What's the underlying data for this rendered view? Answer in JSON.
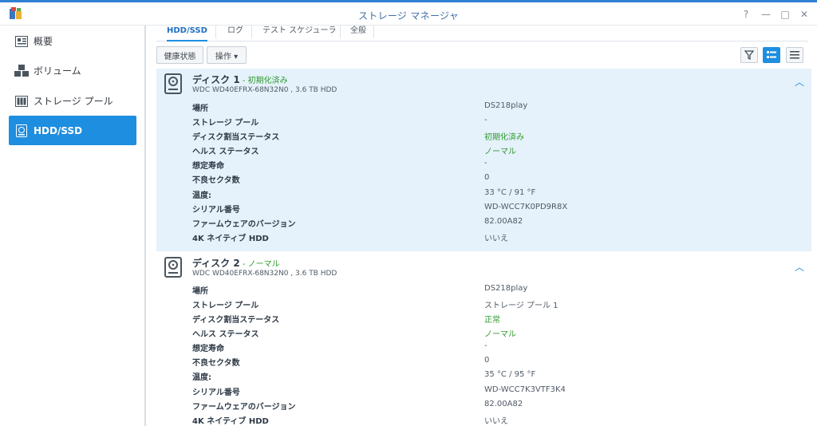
{
  "window": {
    "title": "ストレージ マネージャ",
    "help": "?",
    "minimize": "—",
    "maximize": "□",
    "close": "✕"
  },
  "sidebar": {
    "items": [
      {
        "label": "概要",
        "icon": "overview-icon"
      },
      {
        "label": "ボリューム",
        "icon": "volume-icon"
      },
      {
        "label": "ストレージ プール",
        "icon": "storage-pool-icon"
      },
      {
        "label": "HDD/SSD",
        "icon": "hdd-icon",
        "active": true
      }
    ]
  },
  "tabs": [
    {
      "label": "HDD/SSD",
      "active": true
    },
    {
      "label": "ログ"
    },
    {
      "label": "テスト スケジューラ"
    },
    {
      "label": "全般"
    }
  ],
  "toolbar": {
    "health_label": "健康状態",
    "action_label": "操作 ▾"
  },
  "accent": "#1e8ee0",
  "status_green": "#2e9b2e",
  "disks": [
    {
      "name": "ディスク 1",
      "status": " - 初期化済み",
      "model": "WDC WD40EFRX-68N32N0 , 3.6 TB HDD",
      "rows": [
        {
          "key": "場所",
          "value": "DS218play"
        },
        {
          "key": "ストレージ プール",
          "value": "-"
        },
        {
          "key": "ディスク割当ステータス",
          "value": "初期化済み"
        },
        {
          "key": "ヘルス ステータス",
          "value": "ノーマル"
        },
        {
          "key": "想定寿命",
          "value": "-"
        },
        {
          "key": "不良セクタ数",
          "value": "0"
        },
        {
          "key": "温度:",
          "value": "33 °C / 91 °F"
        },
        {
          "key": "シリアル番号",
          "value": "WD-WCC7K0PD9R8X"
        },
        {
          "key": "ファームウェアのバージョン",
          "value": "82.00A82"
        },
        {
          "key": "4K ネイティブ HDD",
          "value": "いいえ"
        }
      ]
    },
    {
      "name": "ディスク 2",
      "status": " - ノーマル",
      "model": "WDC WD40EFRX-68N32N0 , 3.6 TB HDD",
      "rows": [
        {
          "key": "場所",
          "value": "DS218play"
        },
        {
          "key": "ストレージ プール",
          "value": "ストレージ プール 1"
        },
        {
          "key": "ディスク割当ステータス",
          "value": "正常"
        },
        {
          "key": "ヘルス ステータス",
          "value": "ノーマル"
        },
        {
          "key": "想定寿命",
          "value": "-"
        },
        {
          "key": "不良セクタ数",
          "value": "0"
        },
        {
          "key": "温度:",
          "value": "35 °C / 95 °F"
        },
        {
          "key": "シリアル番号",
          "value": "WD-WCC7K3VTF3K4"
        },
        {
          "key": "ファームウェアのバージョン",
          "value": "82.00A82"
        },
        {
          "key": "4K ネイティブ HDD",
          "value": "いいえ"
        }
      ]
    }
  ]
}
